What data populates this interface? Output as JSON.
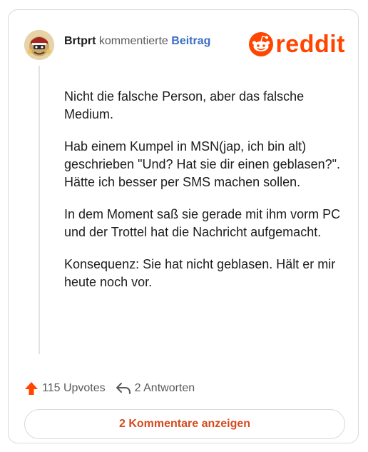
{
  "header": {
    "author": "Brtprt",
    "action": "kommentierte",
    "target": "Beitrag",
    "brand": "reddit"
  },
  "post": {
    "paragraphs": [
      "Nicht die falsche Person, aber das falsche Medium.",
      "Hab einem Kumpel in MSN(jap, ich bin alt) geschrieben \"Und? Hat sie dir einen geblasen?\". Hätte ich besser per SMS machen sollen.",
      "In dem Moment saß sie gerade mit ihm vorm PC und der Trottel hat die Nachricht aufgemacht.",
      "Konsequenz: Sie hat nicht geblasen. Hält er mir heute noch vor."
    ]
  },
  "footer": {
    "upvotes": "115 Upvotes",
    "replies": "2 Antworten",
    "show_comments": "2 Kommentare anzeigen"
  },
  "colors": {
    "brand": "#ff4500",
    "link": "#3a6ec6",
    "button_text": "#d54a1e",
    "upvote": "#ff4500"
  },
  "icons": {
    "brand": "reddit-snoo-icon",
    "upvote": "upvote-arrow-icon",
    "reply": "reply-arrow-icon"
  }
}
